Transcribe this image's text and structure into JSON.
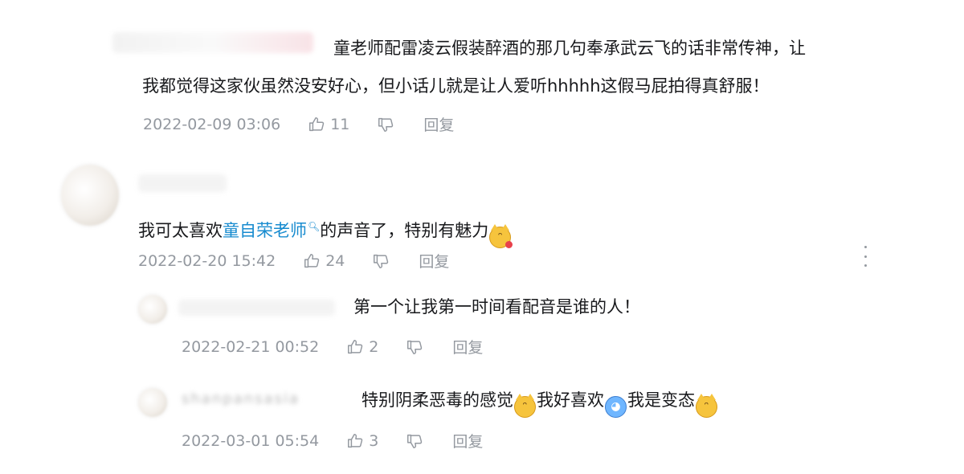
{
  "comments": [
    {
      "text_line1": "童老师配雷凌云假装醉酒的那几句奉承武云飞的话非常传神，让",
      "text_line2": "我都觉得这家伙虽然没安好心，但小话儿就是让人爱听hhhhh这假马屁拍得真舒服！",
      "time": "2022-02-09 03:06",
      "likes": "11",
      "reply_label": "回复"
    },
    {
      "text_before": "我可太喜欢",
      "link_text": "童自荣老师",
      "text_after": "的声音了，特别有魅力",
      "emoji": "smirk-cat-with-rose",
      "time": "2022-02-20 15:42",
      "likes": "24",
      "reply_label": "回复",
      "replies": [
        {
          "text": "第一个让我第一时间看配音是谁的人！",
          "time": "2022-02-21 00:52",
          "likes": "2",
          "reply_label": "回复"
        },
        {
          "text_part1": "特别阴柔恶毒的感觉",
          "text_part2": "我好喜欢",
          "text_part3": "我是变态",
          "emojis": [
            "smirk-cat",
            "crying-face",
            "smirk-cat"
          ],
          "username_blurred": "shanpansasia",
          "time": "2022-03-01 05:54",
          "likes": "3",
          "reply_label": "回复"
        }
      ]
    }
  ],
  "icons": {
    "like": "thumbs-up-icon",
    "dislike": "thumbs-down-icon",
    "more": "more-vertical-icon",
    "search": "search-icon"
  },
  "colors": {
    "text": "#18191c",
    "meta": "#9499a0",
    "link": "#178bcf",
    "emoji": "#f6c43d"
  }
}
